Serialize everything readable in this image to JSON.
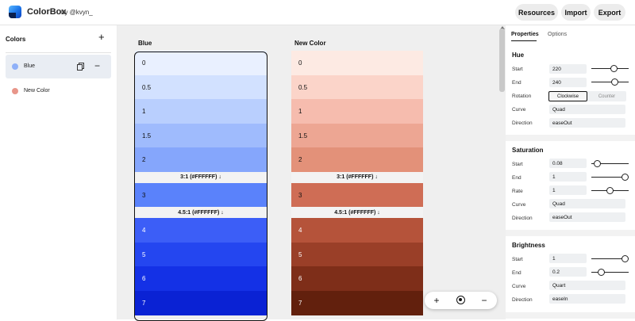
{
  "app": {
    "title": "ColorBox",
    "byline": "by @kvyn_"
  },
  "toolbar": {
    "resources": "Resources",
    "import": "Import",
    "export": "Export"
  },
  "sidebar": {
    "title": "Colors",
    "add_icon": "+",
    "items": [
      {
        "label": "Blue",
        "dot": "#8fb0f8",
        "selected": true
      },
      {
        "label": "New Color",
        "dot": "#e8968a",
        "selected": false
      }
    ]
  },
  "palettes": [
    {
      "name": "Blue",
      "rows": [
        {
          "label": "0",
          "color": "#e9f0ff",
          "text": "#111111"
        },
        {
          "label": "0.5",
          "color": "#d2e1ff",
          "text": "#111111"
        },
        {
          "label": "1",
          "color": "#b9cffe",
          "text": "#111111"
        },
        {
          "label": "1.5",
          "color": "#9fbbfd",
          "text": "#111111"
        },
        {
          "label": "2",
          "color": "#85a6fc",
          "text": "#111111"
        },
        {
          "contrast": "3:1 (#FFFFFF) ↓"
        },
        {
          "label": "3",
          "color": "#5a82fb",
          "text": "#111111"
        },
        {
          "contrast": "4.5:1 (#FFFFFF) ↓"
        },
        {
          "label": "4",
          "color": "#3c5ef7",
          "text": "#ffffff"
        },
        {
          "label": "5",
          "color": "#2446f0",
          "text": "#ffffff"
        },
        {
          "label": "6",
          "color": "#1431e6",
          "text": "#ffffff"
        },
        {
          "label": "7",
          "color": "#0a22d4",
          "text": "#ffffff"
        }
      ]
    },
    {
      "name": "New Color",
      "rows": [
        {
          "label": "0",
          "color": "#fdeae3",
          "text": "#111111"
        },
        {
          "label": "0.5",
          "color": "#fbd4c9",
          "text": "#111111"
        },
        {
          "label": "1",
          "color": "#f6bcae",
          "text": "#111111"
        },
        {
          "label": "1.5",
          "color": "#eda693",
          "text": "#111111"
        },
        {
          "label": "2",
          "color": "#e39179",
          "text": "#111111"
        },
        {
          "contrast": "3:1 (#FFFFFF) ↓"
        },
        {
          "label": "3",
          "color": "#cf6d55",
          "text": "#111111"
        },
        {
          "contrast": "4.5:1 (#FFFFFF) ↓"
        },
        {
          "label": "4",
          "color": "#b5533a",
          "text": "#ffffff"
        },
        {
          "label": "5",
          "color": "#9a3f28",
          "text": "#ffffff"
        },
        {
          "label": "6",
          "color": "#7e2e19",
          "text": "#ffffff"
        },
        {
          "label": "7",
          "color": "#62200d",
          "text": "#ffffff"
        }
      ]
    }
  ],
  "zoom": {
    "plus": "+",
    "minus": "−"
  },
  "properties": {
    "tabs": [
      "Properties",
      "Options"
    ],
    "hue": {
      "title": "Hue",
      "start_label": "Start",
      "start": "220",
      "start_level": 0.63,
      "end_label": "End",
      "end": "240",
      "end_level": 0.67,
      "rotation_label": "Rotation",
      "rotation_options": [
        "Clockwise",
        "Counter"
      ],
      "rotation_selected": "Clockwise",
      "curve_label": "Curve",
      "curve": "Quad",
      "direction_label": "Direction",
      "direction": "easeOut"
    },
    "saturation": {
      "title": "Saturation",
      "start_label": "Start",
      "start": "0.08",
      "start_level": 0.08,
      "end_label": "End",
      "end": "1",
      "end_level": 1.0,
      "rate_label": "Rate",
      "rate": "1",
      "rate_level": 0.5,
      "curve_label": "Curve",
      "curve": "Quad",
      "direction_label": "Direction",
      "direction": "easeOut"
    },
    "brightness": {
      "title": "Brightness",
      "start_label": "Start",
      "start": "1",
      "start_level": 1.0,
      "end_label": "End",
      "end": "0.2",
      "end_level": 0.2,
      "curve_label": "Curve",
      "curve": "Quart",
      "direction_label": "Direction",
      "direction": "easeIn"
    }
  }
}
